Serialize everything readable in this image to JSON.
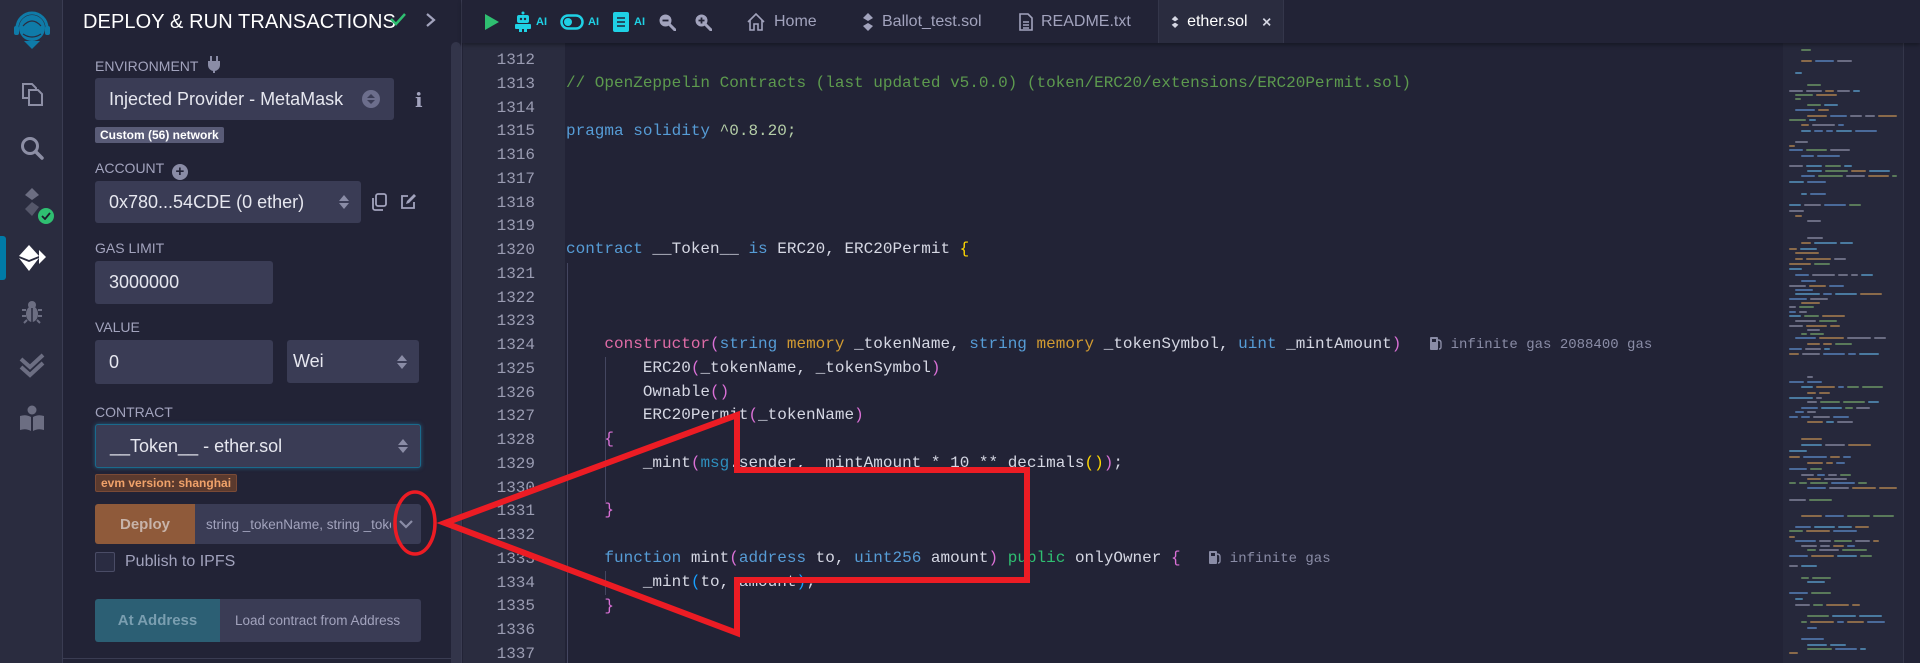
{
  "iconbar": {
    "items": [
      {
        "name": "remix-logo",
        "active": false
      },
      {
        "name": "file-explorer",
        "active": false
      },
      {
        "name": "search",
        "active": false
      },
      {
        "name": "solidity-compiler",
        "active": false,
        "badge": "check"
      },
      {
        "name": "deploy-run",
        "active": true
      },
      {
        "name": "debugger",
        "active": false
      },
      {
        "name": "solidity-unit-testing",
        "active": false
      },
      {
        "name": "learneth",
        "active": false
      }
    ]
  },
  "panel": {
    "title": "DEPLOY & RUN TRANSACTIONS",
    "environment": {
      "label": "ENVIRONMENT",
      "value": "Injected Provider - MetaMask",
      "network_badge": "Custom (56) network"
    },
    "account": {
      "label": "ACCOUNT",
      "value": "0x780...54CDE (0 ether)"
    },
    "gas_limit": {
      "label": "GAS LIMIT",
      "value": "3000000"
    },
    "value": {
      "label": "VALUE",
      "amount": "0",
      "unit": "Wei"
    },
    "contract": {
      "label": "CONTRACT",
      "value": "__Token__ - ether.sol",
      "evm_badge": "evm version: shanghai"
    },
    "deploy": {
      "button": "Deploy",
      "params_placeholder": "string _tokenName, string _toke"
    },
    "publish_ipfs": {
      "label": "Publish to IPFS",
      "checked": false
    },
    "at_address": {
      "button": "At Address",
      "placeholder": "Load contract from Address"
    }
  },
  "tabbar": {
    "ai_label": "AI",
    "tabs": [
      {
        "label": "Home",
        "icon": "home-icon",
        "active": false
      },
      {
        "label": "Ballot_test.sol",
        "icon": "solidity-icon",
        "active": false
      },
      {
        "label": "README.txt",
        "icon": "file-text-icon",
        "active": false
      },
      {
        "label": "ether.sol",
        "icon": "solidity-icon",
        "active": true
      }
    ]
  },
  "editor": {
    "lines": [
      {
        "n": "1312"
      },
      {
        "n": "1313"
      },
      {
        "n": "1314"
      },
      {
        "n": "1315"
      },
      {
        "n": "1316"
      },
      {
        "n": "1317"
      },
      {
        "n": "1318"
      },
      {
        "n": "1319"
      },
      {
        "n": "1320"
      },
      {
        "n": "1321"
      },
      {
        "n": "1322"
      },
      {
        "n": "1323"
      },
      {
        "n": "1324"
      },
      {
        "n": "1325"
      },
      {
        "n": "1326"
      },
      {
        "n": "1327"
      },
      {
        "n": "1328"
      },
      {
        "n": "1329"
      },
      {
        "n": "1330"
      },
      {
        "n": "1331"
      },
      {
        "n": "1332"
      },
      {
        "n": "1333"
      },
      {
        "n": "1334"
      },
      {
        "n": "1335"
      },
      {
        "n": "1336"
      },
      {
        "n": "1337"
      }
    ],
    "code": {
      "l1313": "// OpenZeppelin Contracts (last updated v5.0.0) (token/ERC20/extensions/ERC20Permit.sol)",
      "l1315_kw": "pragma solidity",
      "l1315_ver": " ^0.8.20;",
      "l1320_kw": "contract",
      "l1320_name": " __Token__ ",
      "l1320_is": "is",
      "l1320_rest": " ERC20, ERC20Permit ",
      "l1324_ctor": "constructor",
      "l1324_t1": "string",
      "l1324_m1": "memory",
      "l1324_p1": " _tokenName, ",
      "l1324_t2": "string",
      "l1324_m2": "memory",
      "l1324_p2": " _tokenSymbol, ",
      "l1324_t3": "uint",
      "l1324_p3": " _mintAmount",
      "l1324_hint": "infinite gas 2088400 gas",
      "l1325": "ERC20",
      "l1325_args": "_tokenName, _tokenSymbol",
      "l1326": "Ownable",
      "l1327": "ERC20Permit",
      "l1327_args": "_tokenName",
      "l1329_fn": "_mint",
      "l1329_msg": "msg",
      "l1329_rest": ".sender, _mintAmount * 10 ** decimals",
      "l1333_fn": "function",
      "l1333_name": " mint",
      "l1333_t1": "address",
      "l1333_p1": " to, ",
      "l1333_t2": "uint256",
      "l1333_p2": " amount",
      "l1333_pub": "public",
      "l1333_mod": " onlyOwner ",
      "l1333_hint": "infinite gas",
      "l1334_fn": "_mint",
      "l1334_args": "to, amount"
    }
  },
  "annotation": {
    "color": "#ec1c24",
    "shape": "arrow pointing left to the deploy parameters expand chevron, with ellipse highlight"
  }
}
